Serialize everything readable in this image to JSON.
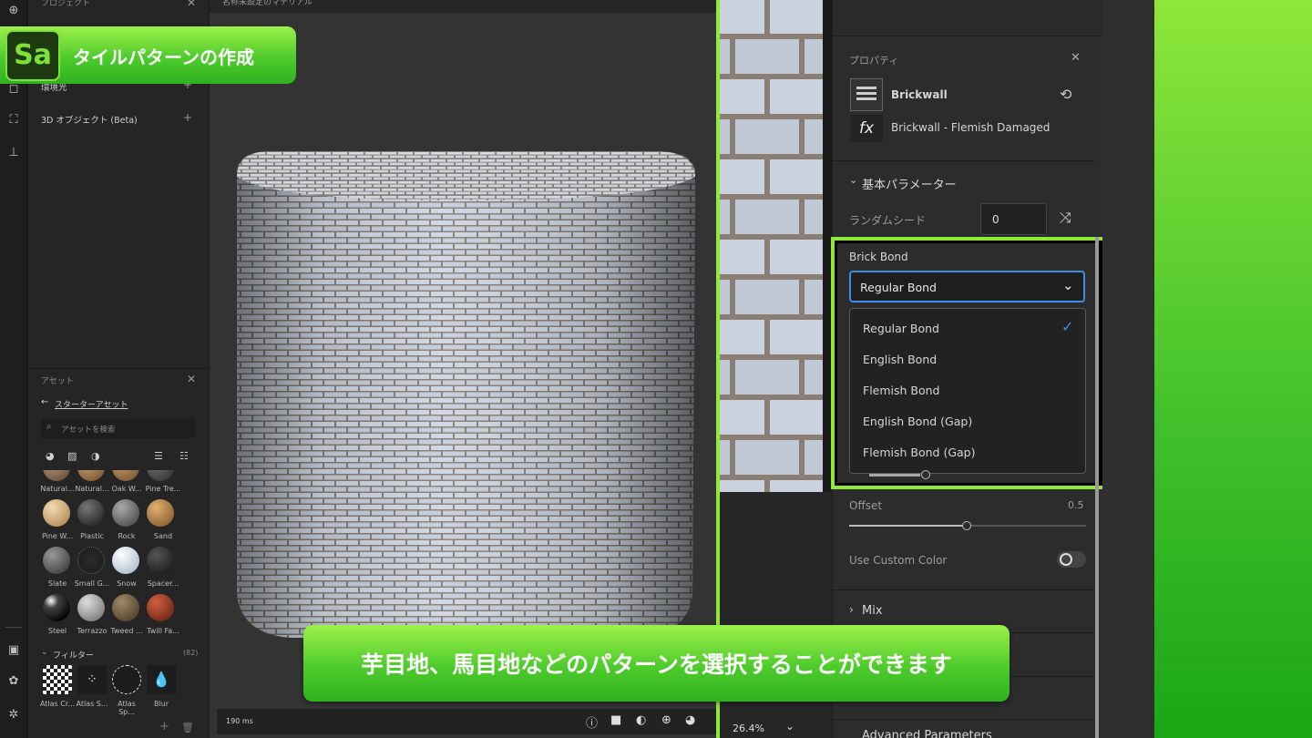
{
  "toolbar": {
    "icons": [
      "add-icon",
      "shape-icon",
      "crop-icon",
      "stamp-icon",
      "screen-icon",
      "fx-icon",
      "settings-icon"
    ]
  },
  "left_panel": {
    "project_header": "プロジェクト",
    "environment_label": "環境光",
    "objects_label": "3D オブジェクト (Beta)",
    "assets_header": "アセット",
    "starter_link": "スターターアセット",
    "search_placeholder": "アセットを検索",
    "materials": [
      {
        "label": "Natural..."
      },
      {
        "label": "Natural..."
      },
      {
        "label": "Oak W..."
      },
      {
        "label": "Pine Tre..."
      },
      {
        "label": "Pine W..."
      },
      {
        "label": "Plastic"
      },
      {
        "label": "Rock"
      },
      {
        "label": "Sand"
      },
      {
        "label": "Slate"
      },
      {
        "label": "Small G..."
      },
      {
        "label": "Snow"
      },
      {
        "label": "Spacer..."
      },
      {
        "label": "Steel"
      },
      {
        "label": "Terrazzo"
      },
      {
        "label": "Tweed ..."
      },
      {
        "label": "Twill Fa..."
      }
    ],
    "filters_label": "フィルター",
    "filters_count": "(82)",
    "filters": [
      {
        "label": "Atlas Cr..."
      },
      {
        "label": "Atlas S..."
      },
      {
        "label": "Atlas Sp..."
      },
      {
        "label": "Blur"
      }
    ]
  },
  "viewport": {
    "title": "名称未設定のマテリアル",
    "render_time": "190 ms"
  },
  "texture_view": {
    "zoom": "26.4%"
  },
  "properties": {
    "header": "プロパティ",
    "material_name": "Brickwall",
    "material_variant": "Brickwall - Flemish Damaged",
    "section_basic": "基本パラメーター",
    "random_seed_label": "ランダムシード",
    "random_seed_value": "0",
    "brick_bond_label": "Brick Bond",
    "brick_bond_selected": "Regular Bond",
    "brick_bond_options": [
      "Regular Bond",
      "English Bond",
      "Flemish Bond",
      "English Bond (Gap)",
      "Flemish Bond (Gap)"
    ],
    "offset_label": "Offset",
    "offset_value": "0.5",
    "use_custom_color_label": "Use Custom Color",
    "section_mix": "Mix",
    "section_advanced": "Advanced Parameters"
  },
  "overlay": {
    "app_badge": "Sa",
    "title_banner": "タイルパターンの作成",
    "caption": "芋目地、馬目地などのパターンを選択することができます"
  },
  "colors": {
    "accent_green": "#4ecb2c",
    "highlight_border": "#8fe83c",
    "select_blue": "#3d8ee8"
  }
}
